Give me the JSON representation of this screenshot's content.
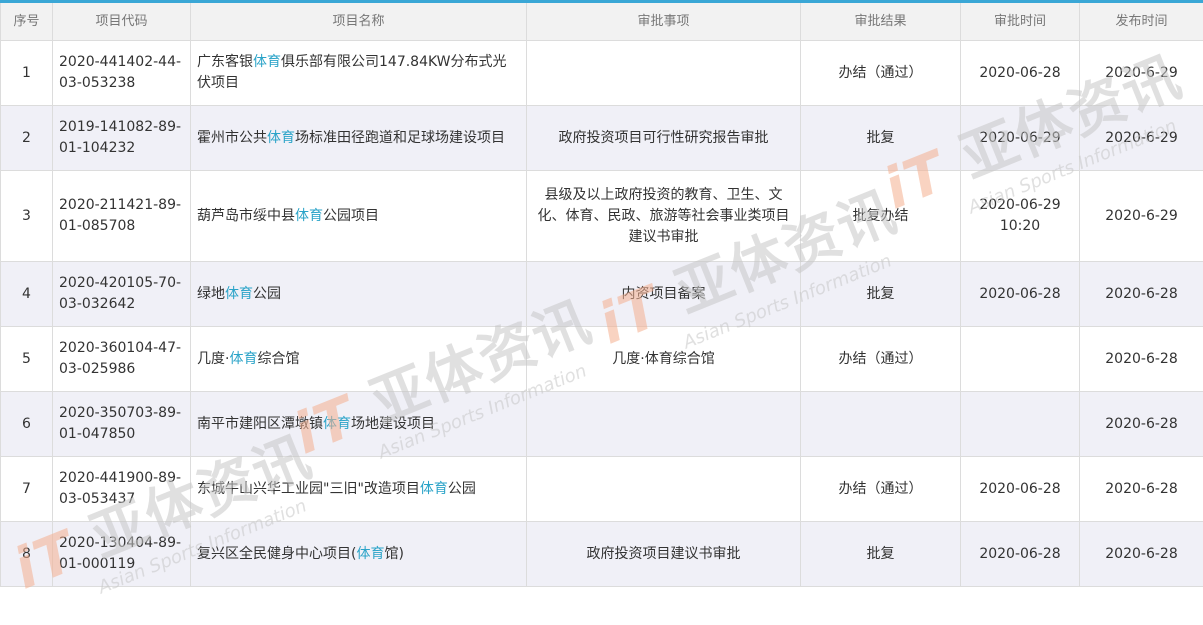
{
  "table": {
    "headers": [
      "序号",
      "项目代码",
      "项目名称",
      "审批事项",
      "审批结果",
      "审批时间",
      "发布时间"
    ],
    "rows": [
      {
        "no": "1",
        "code": "2020-441402-44-03-053238",
        "name_pre": "广东客银",
        "name_hl": "体育",
        "name_post": "俱乐部有限公司147.84KW分布式光伏项目",
        "item": "",
        "result": "办结（通过）",
        "time": "2020-06-28",
        "pub": "2020-6-29"
      },
      {
        "no": "2",
        "code": "2019-141082-89-01-104232",
        "name_pre": "霍州市公共",
        "name_hl": "体育",
        "name_post": "场标准田径跑道和足球场建设项目",
        "item": "政府投资项目可行性研究报告审批",
        "result": "批复",
        "time": "2020-06-29",
        "pub": "2020-6-29"
      },
      {
        "no": "3",
        "code": "2020-211421-89-01-085708",
        "name_pre": "葫芦岛市绥中县",
        "name_hl": "体育",
        "name_post": "公园项目",
        "item": "县级及以上政府投资的教育、卫生、文化、体育、民政、旅游等社会事业类项目建议书审批",
        "result": "批复办结",
        "time": "2020-06-29 10:20",
        "pub": "2020-6-29"
      },
      {
        "no": "4",
        "code": "2020-420105-70-03-032642",
        "name_pre": "绿地",
        "name_hl": "体育",
        "name_post": "公园",
        "item": "内资项目备案",
        "result": "批复",
        "time": "2020-06-28",
        "pub": "2020-6-28"
      },
      {
        "no": "5",
        "code": "2020-360104-47-03-025986",
        "name_pre": "几度·",
        "name_hl": "体育",
        "name_post": "综合馆",
        "item": "几度·体育综合馆",
        "result": "办结（通过）",
        "time": "",
        "pub": "2020-6-28"
      },
      {
        "no": "6",
        "code": "2020-350703-89-01-047850",
        "name_pre": "南平市建阳区潭墩镇",
        "name_hl": "体育",
        "name_post": "场地建设项目",
        "item": "",
        "result": "",
        "time": "",
        "pub": "2020-6-28"
      },
      {
        "no": "7",
        "code": "2020-441900-89-03-053437",
        "name_pre": "东城牛山兴华工业园\"三旧\"改造项目",
        "name_hl": "体育",
        "name_post": "公园",
        "item": "",
        "result": "办结（通过）",
        "time": "2020-06-28",
        "pub": "2020-6-28"
      },
      {
        "no": "8",
        "code": "2020-130404-89-01-000119",
        "name_pre": "复兴区全民健身中心项目(",
        "name_hl": "体育",
        "name_post": "馆)",
        "item": "政府投资项目建议书审批",
        "result": "批复",
        "time": "2020-06-28",
        "pub": "2020-6-28"
      }
    ]
  },
  "watermark": {
    "logo_text": "亚体资讯",
    "sub_text": "Asian Sports Information"
  },
  "colors": {
    "highlight": "#2aa3c8",
    "header_accent": "#3aa7d6",
    "row_alt": "#f0f0f7"
  }
}
